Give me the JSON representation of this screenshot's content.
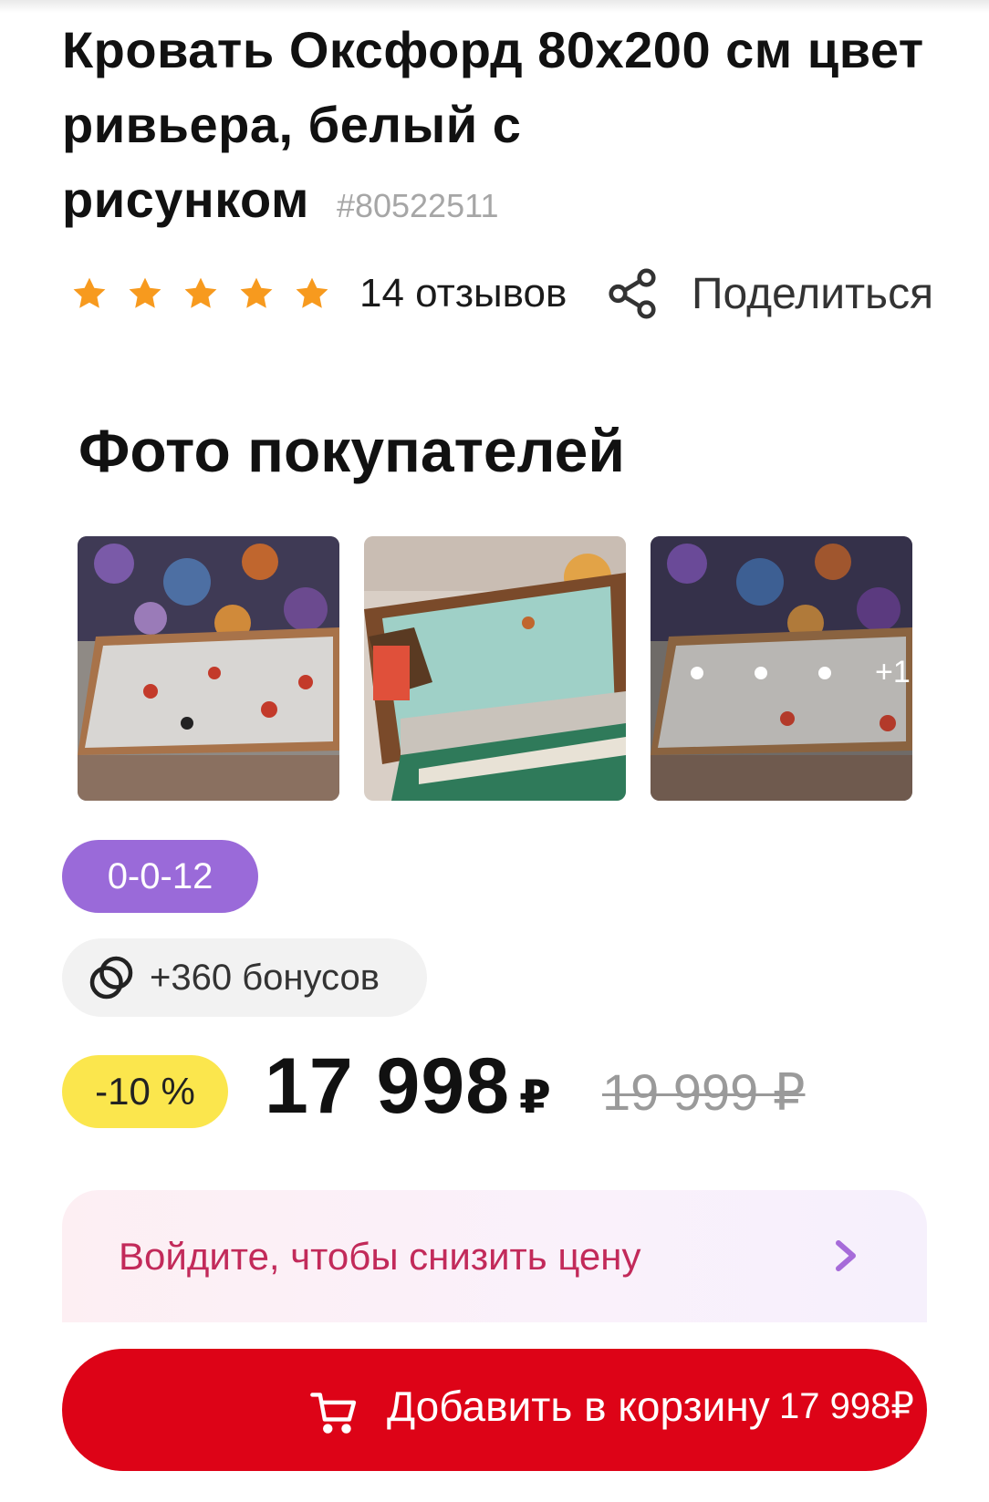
{
  "product": {
    "title": "Кровать Оксфорд 80х200 см цвет ривьера, белый с рисунком",
    "sku": "#80522511"
  },
  "rating": {
    "stars": 5,
    "reviews_label": "14 отзывов",
    "star_color": "#f79a1e"
  },
  "share": {
    "label": "Поделиться",
    "icon": "share-icon"
  },
  "customer_photos": {
    "title": "Фото покупателей",
    "more_count": "+1",
    "photos": [
      {
        "alt": "bed-photo-1"
      },
      {
        "alt": "bed-photo-2"
      },
      {
        "alt": "bed-photo-3"
      }
    ]
  },
  "installment": {
    "label": "0-0-12",
    "color": "#9a6ad9"
  },
  "bonus": {
    "label": "+360 бонусов",
    "icon": "bonus-coins-icon"
  },
  "price": {
    "discount": "-10 %",
    "current": "17 998",
    "currency": "₽",
    "old": "19 999 ₽",
    "discount_color": "#fbe64d"
  },
  "login_banner": {
    "text": "Войдите, чтобы снизить цену",
    "text_color": "#c22a5a"
  },
  "cart": {
    "label": "Добавить в корзину",
    "price": "17 998₽",
    "color": "#dd0317",
    "icon": "cart-icon"
  }
}
